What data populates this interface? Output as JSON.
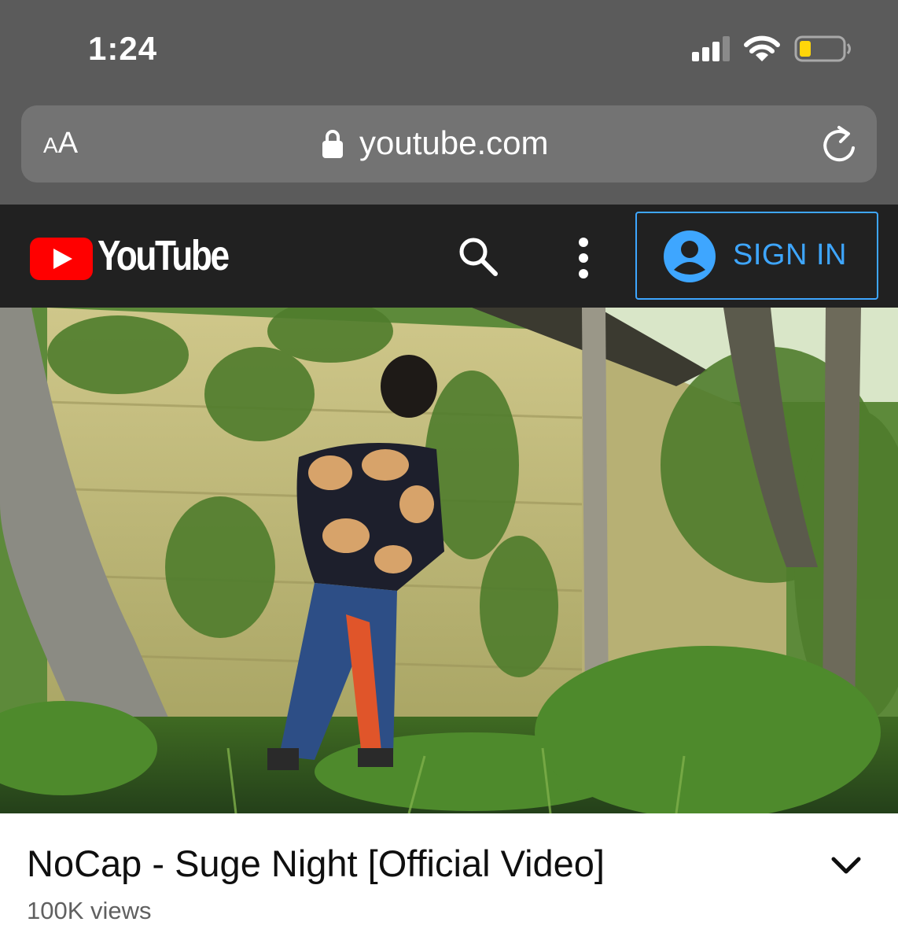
{
  "status_bar": {
    "time": "1:24",
    "signal_icon": "cellular-signal-icon",
    "wifi_icon": "wifi-icon",
    "battery_icon": "battery-low-icon",
    "battery_color": "#ffd60a"
  },
  "browser": {
    "text_size_label_small": "A",
    "text_size_label_large": "A",
    "lock_icon": "lock-icon",
    "url": "youtube.com",
    "reload_icon": "reload-icon"
  },
  "youtube_header": {
    "logo_text": "YouTube",
    "search_icon": "search-icon",
    "more_icon": "more-vertical-icon",
    "sign_in_label": "SIGN IN",
    "account_icon": "account-circle-icon",
    "accent_color": "#3ea6ff",
    "brand_color": "#ff0000"
  },
  "video": {
    "title": "NoCap - Suge Night [Official Video]",
    "views": "100K views",
    "expand_icon": "chevron-down-icon"
  }
}
